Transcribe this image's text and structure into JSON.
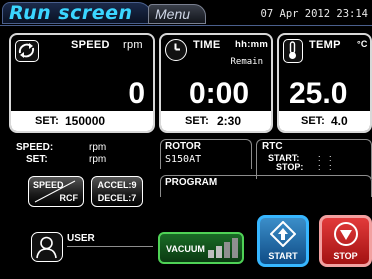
{
  "header": {
    "tabs": [
      {
        "label": "Run screen"
      },
      {
        "label": "Menu"
      }
    ],
    "clock": "07 Apr 2012 23:14"
  },
  "speed_panel": {
    "title": "SPEED",
    "unit": "rpm",
    "value": "0",
    "set_label": "SET:",
    "set_value": "150000"
  },
  "time_panel": {
    "title": "TIME",
    "unit": "hh:mm",
    "sublabel": "Remain",
    "value": "0:00",
    "set_label": "SET:",
    "set_value": "2:30"
  },
  "temp_panel": {
    "title": "TEMP",
    "unit": "°C",
    "value": "25.0",
    "set_label": "SET:",
    "set_value": "4.0"
  },
  "rcf_info": {
    "speed_label": "SPEED:",
    "speed_unit": "rpm",
    "set_label": "SET:",
    "set_unit": "rpm"
  },
  "buttons": {
    "speed_rcf_top": "SPEED",
    "speed_rcf_bottom": "RCF",
    "accel": "ACCEL:9",
    "decel": "DECEL:7",
    "user": "USER",
    "vacuum": "VACUUM",
    "start": "START",
    "stop": "STOP"
  },
  "rotor": {
    "title": "ROTOR",
    "value": "S150AT"
  },
  "rtc": {
    "title": "RTC",
    "start_label": "START:",
    "stop_label": "STOP:",
    "start_value": ":  :",
    "stop_value": ":  :"
  },
  "program": {
    "title": "PROGRAM"
  },
  "colors": {
    "accent": "#3bd6ff",
    "start": "#1f6fb5",
    "stop": "#d42525",
    "vacuum": "#2a8c34"
  },
  "icons": [
    "rotate-icon",
    "clock-icon",
    "thermometer-icon",
    "user-icon",
    "start-icon",
    "stop-icon"
  ]
}
